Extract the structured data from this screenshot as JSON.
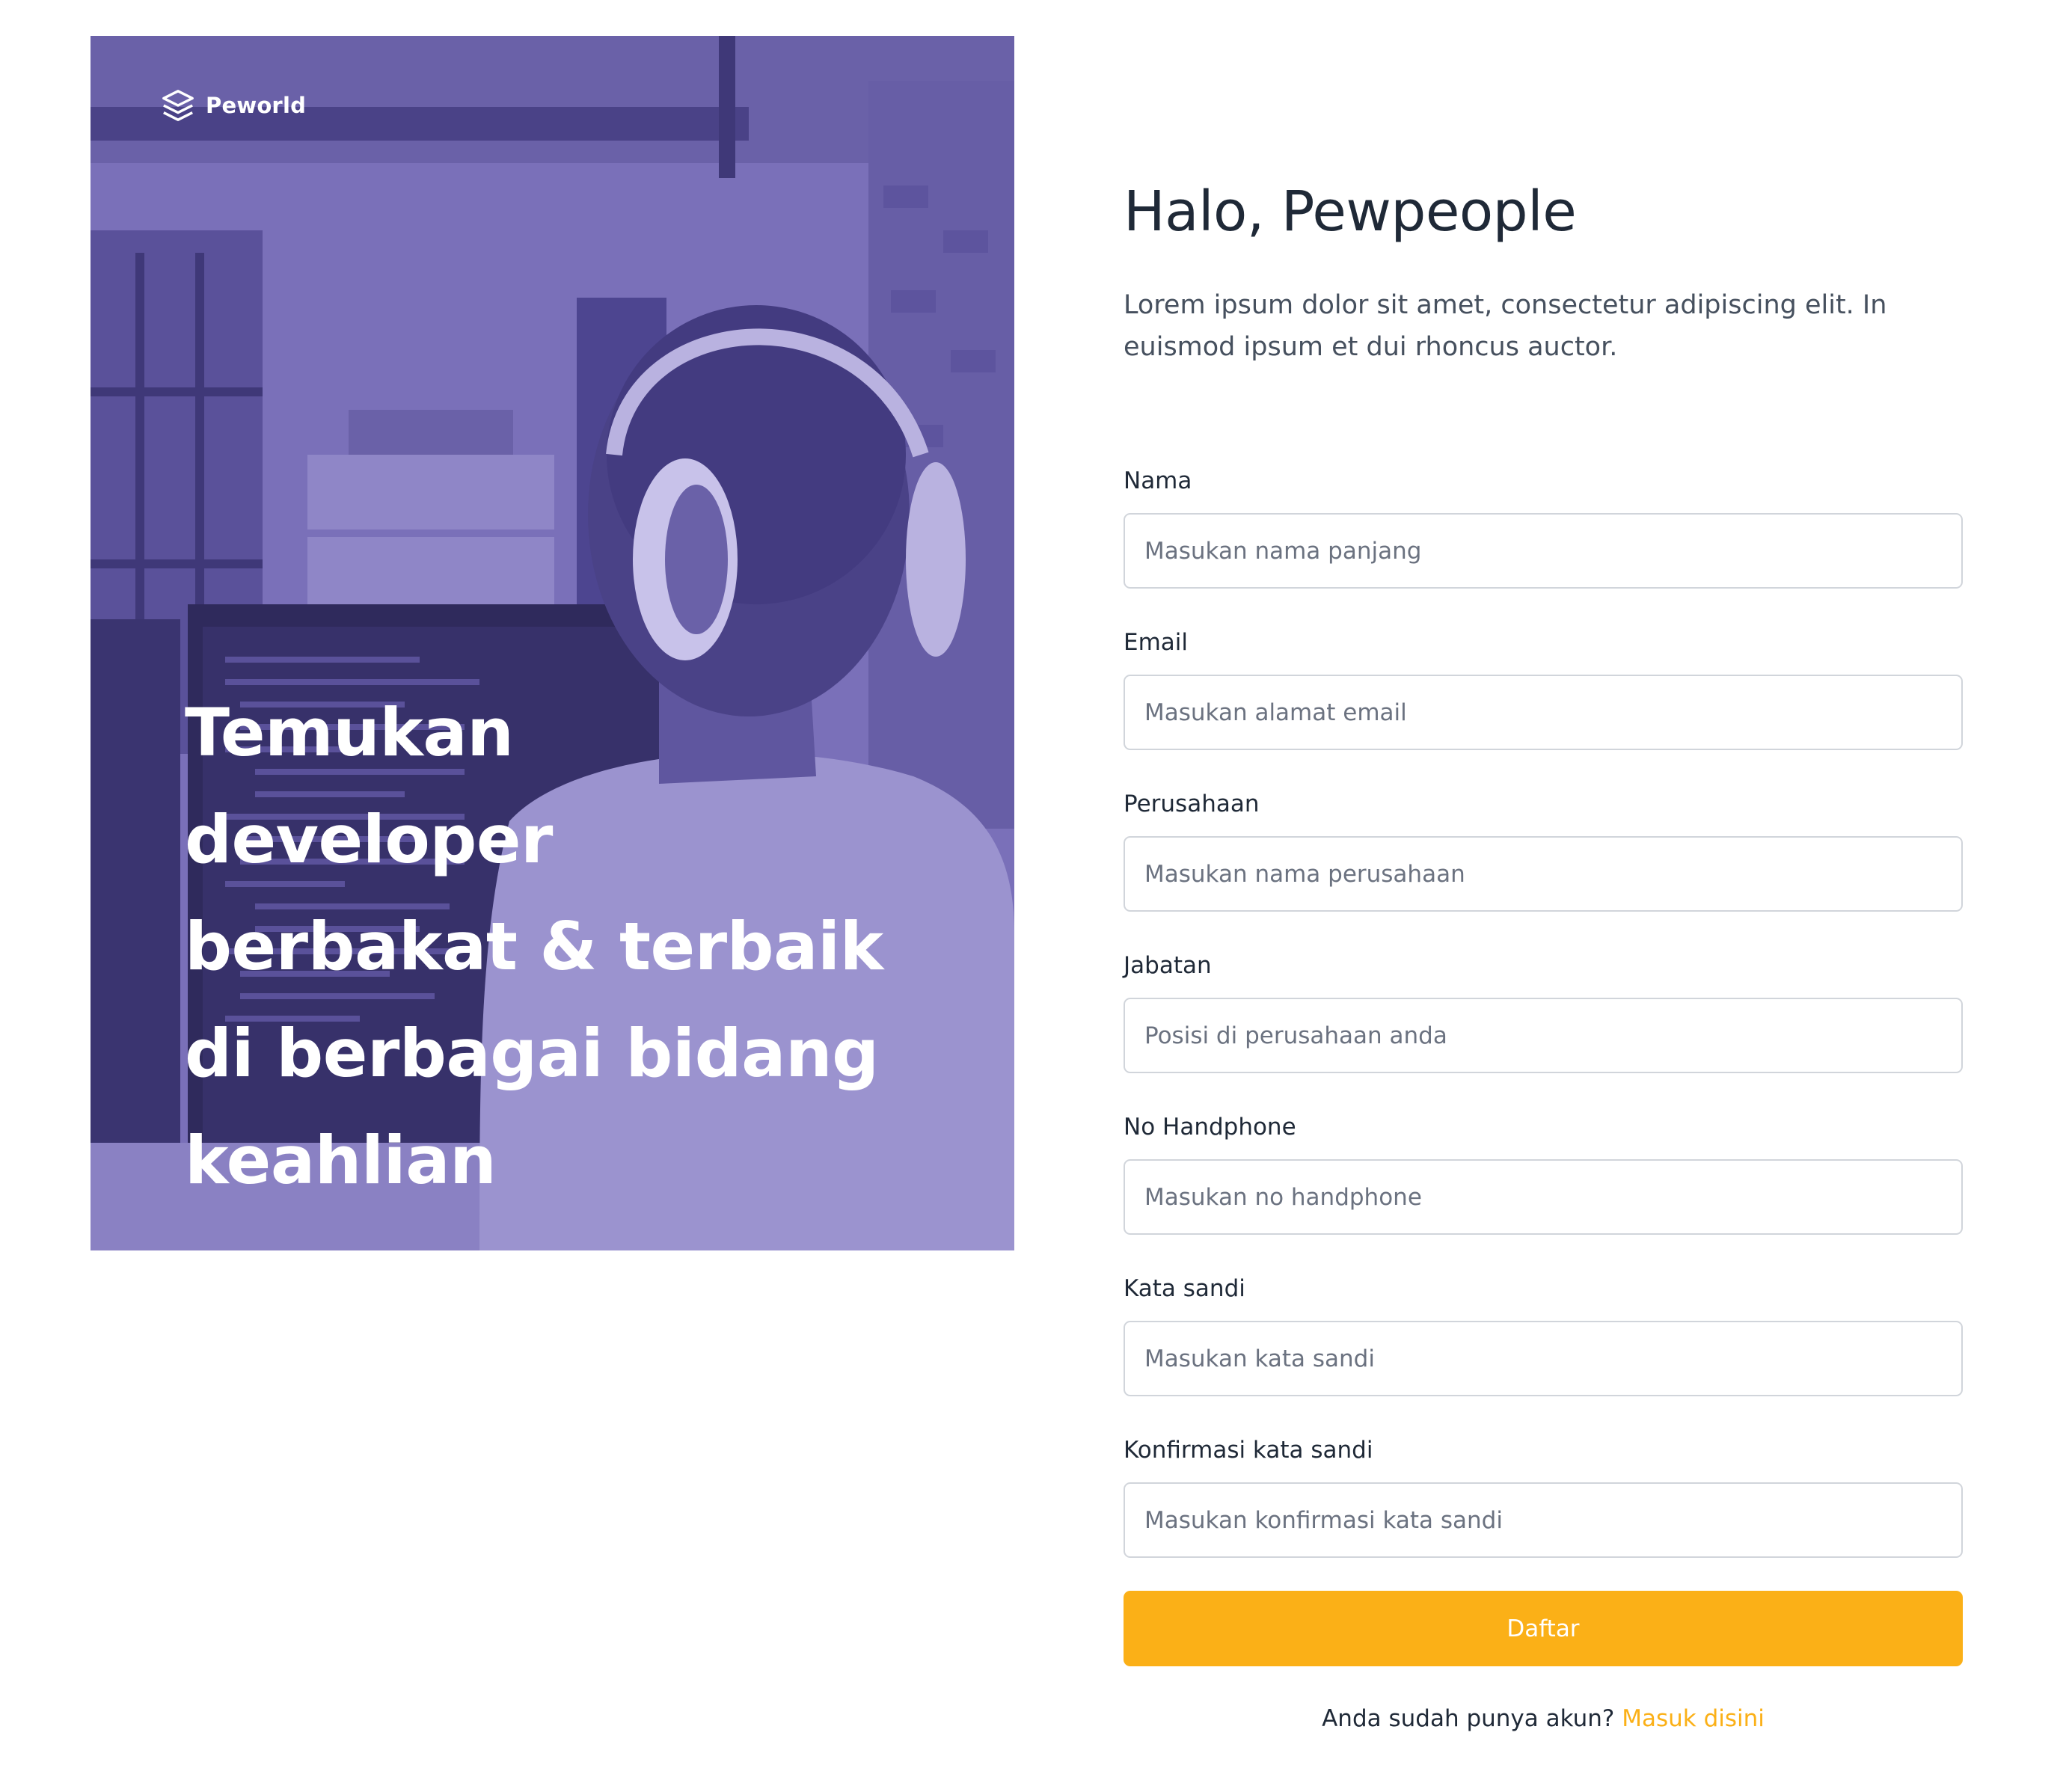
{
  "brand": {
    "name": "Peworld",
    "icon": "layers-icon"
  },
  "hero": {
    "headline": "Temukan developer berbakat & terbaik di berbagai bidang keahlian",
    "overlay_color": "#7a70b9"
  },
  "form": {
    "title": "Halo, Pewpeople",
    "subtitle": "Lorem ipsum dolor sit amet, consectetur adipiscing elit. In euismod ipsum et dui rhoncus auctor.",
    "fields": [
      {
        "label": "Nama",
        "placeholder": "Masukan nama panjang",
        "type": "text"
      },
      {
        "label": "Email",
        "placeholder": "Masukan alamat email",
        "type": "email"
      },
      {
        "label": "Perusahaan",
        "placeholder": "Masukan nama perusahaan",
        "type": "text"
      },
      {
        "label": "Jabatan",
        "placeholder": "Posisi di perusahaan anda",
        "type": "text"
      },
      {
        "label": "No Handphone",
        "placeholder": "Masukan no handphone",
        "type": "tel"
      },
      {
        "label": "Kata sandi",
        "placeholder": "Masukan kata sandi",
        "type": "password"
      },
      {
        "label": "Konfirmasi kata sandi",
        "placeholder": "Masukan konfirmasi kata sandi",
        "type": "password"
      }
    ],
    "submit_label": "Daftar",
    "login_prompt": "Anda sudah punya akun?",
    "login_link": "Masuk disini"
  },
  "colors": {
    "accent": "#fbb017",
    "hero_purple": "#7a70b9",
    "text_dark": "#1f2937",
    "text_muted": "#46505e",
    "input_border": "#d1d5db"
  }
}
